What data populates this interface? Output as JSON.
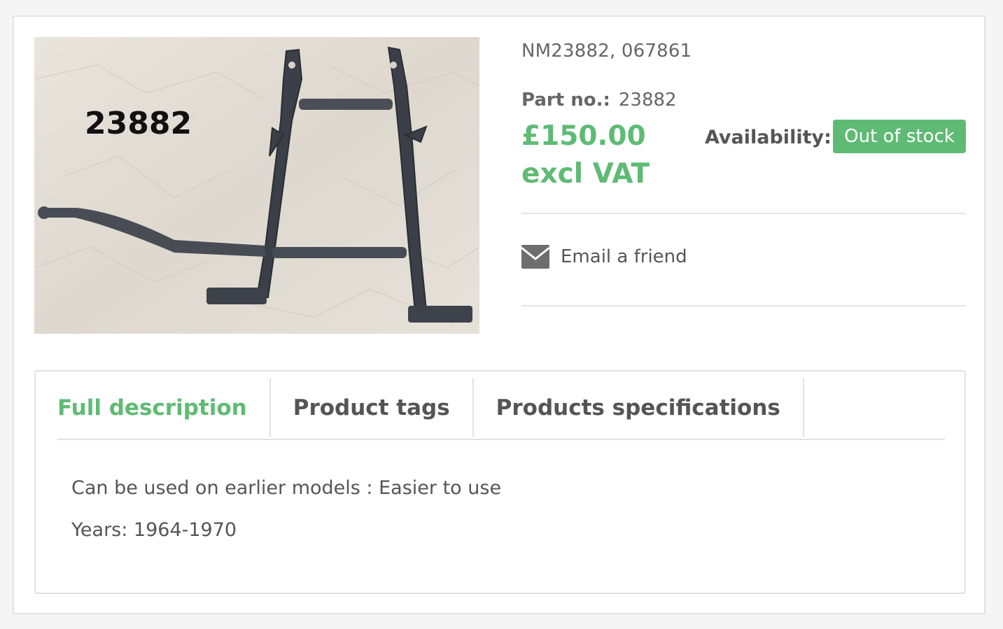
{
  "product": {
    "image_label": "23882",
    "sku": "NM23882, 067861",
    "part_no_label": "Part no.:",
    "part_no_value": "23882",
    "price": "£150.00 excl VAT",
    "availability_label": "Availability:",
    "availability_value": "Out of stock",
    "email_a_friend": "Email a friend",
    "colors": {
      "accent": "#5fbb74",
      "text": "#555555",
      "border": "#e2e2e2"
    }
  },
  "tabs": [
    {
      "label": "Full description",
      "active": true
    },
    {
      "label": "Product tags",
      "active": false
    },
    {
      "label": "Products specifications",
      "active": false
    }
  ],
  "description": {
    "line1": "Can be used on earlier models : Easier to use",
    "line2": "Years: 1964-1970"
  },
  "icons": {
    "email": "envelope-icon"
  }
}
